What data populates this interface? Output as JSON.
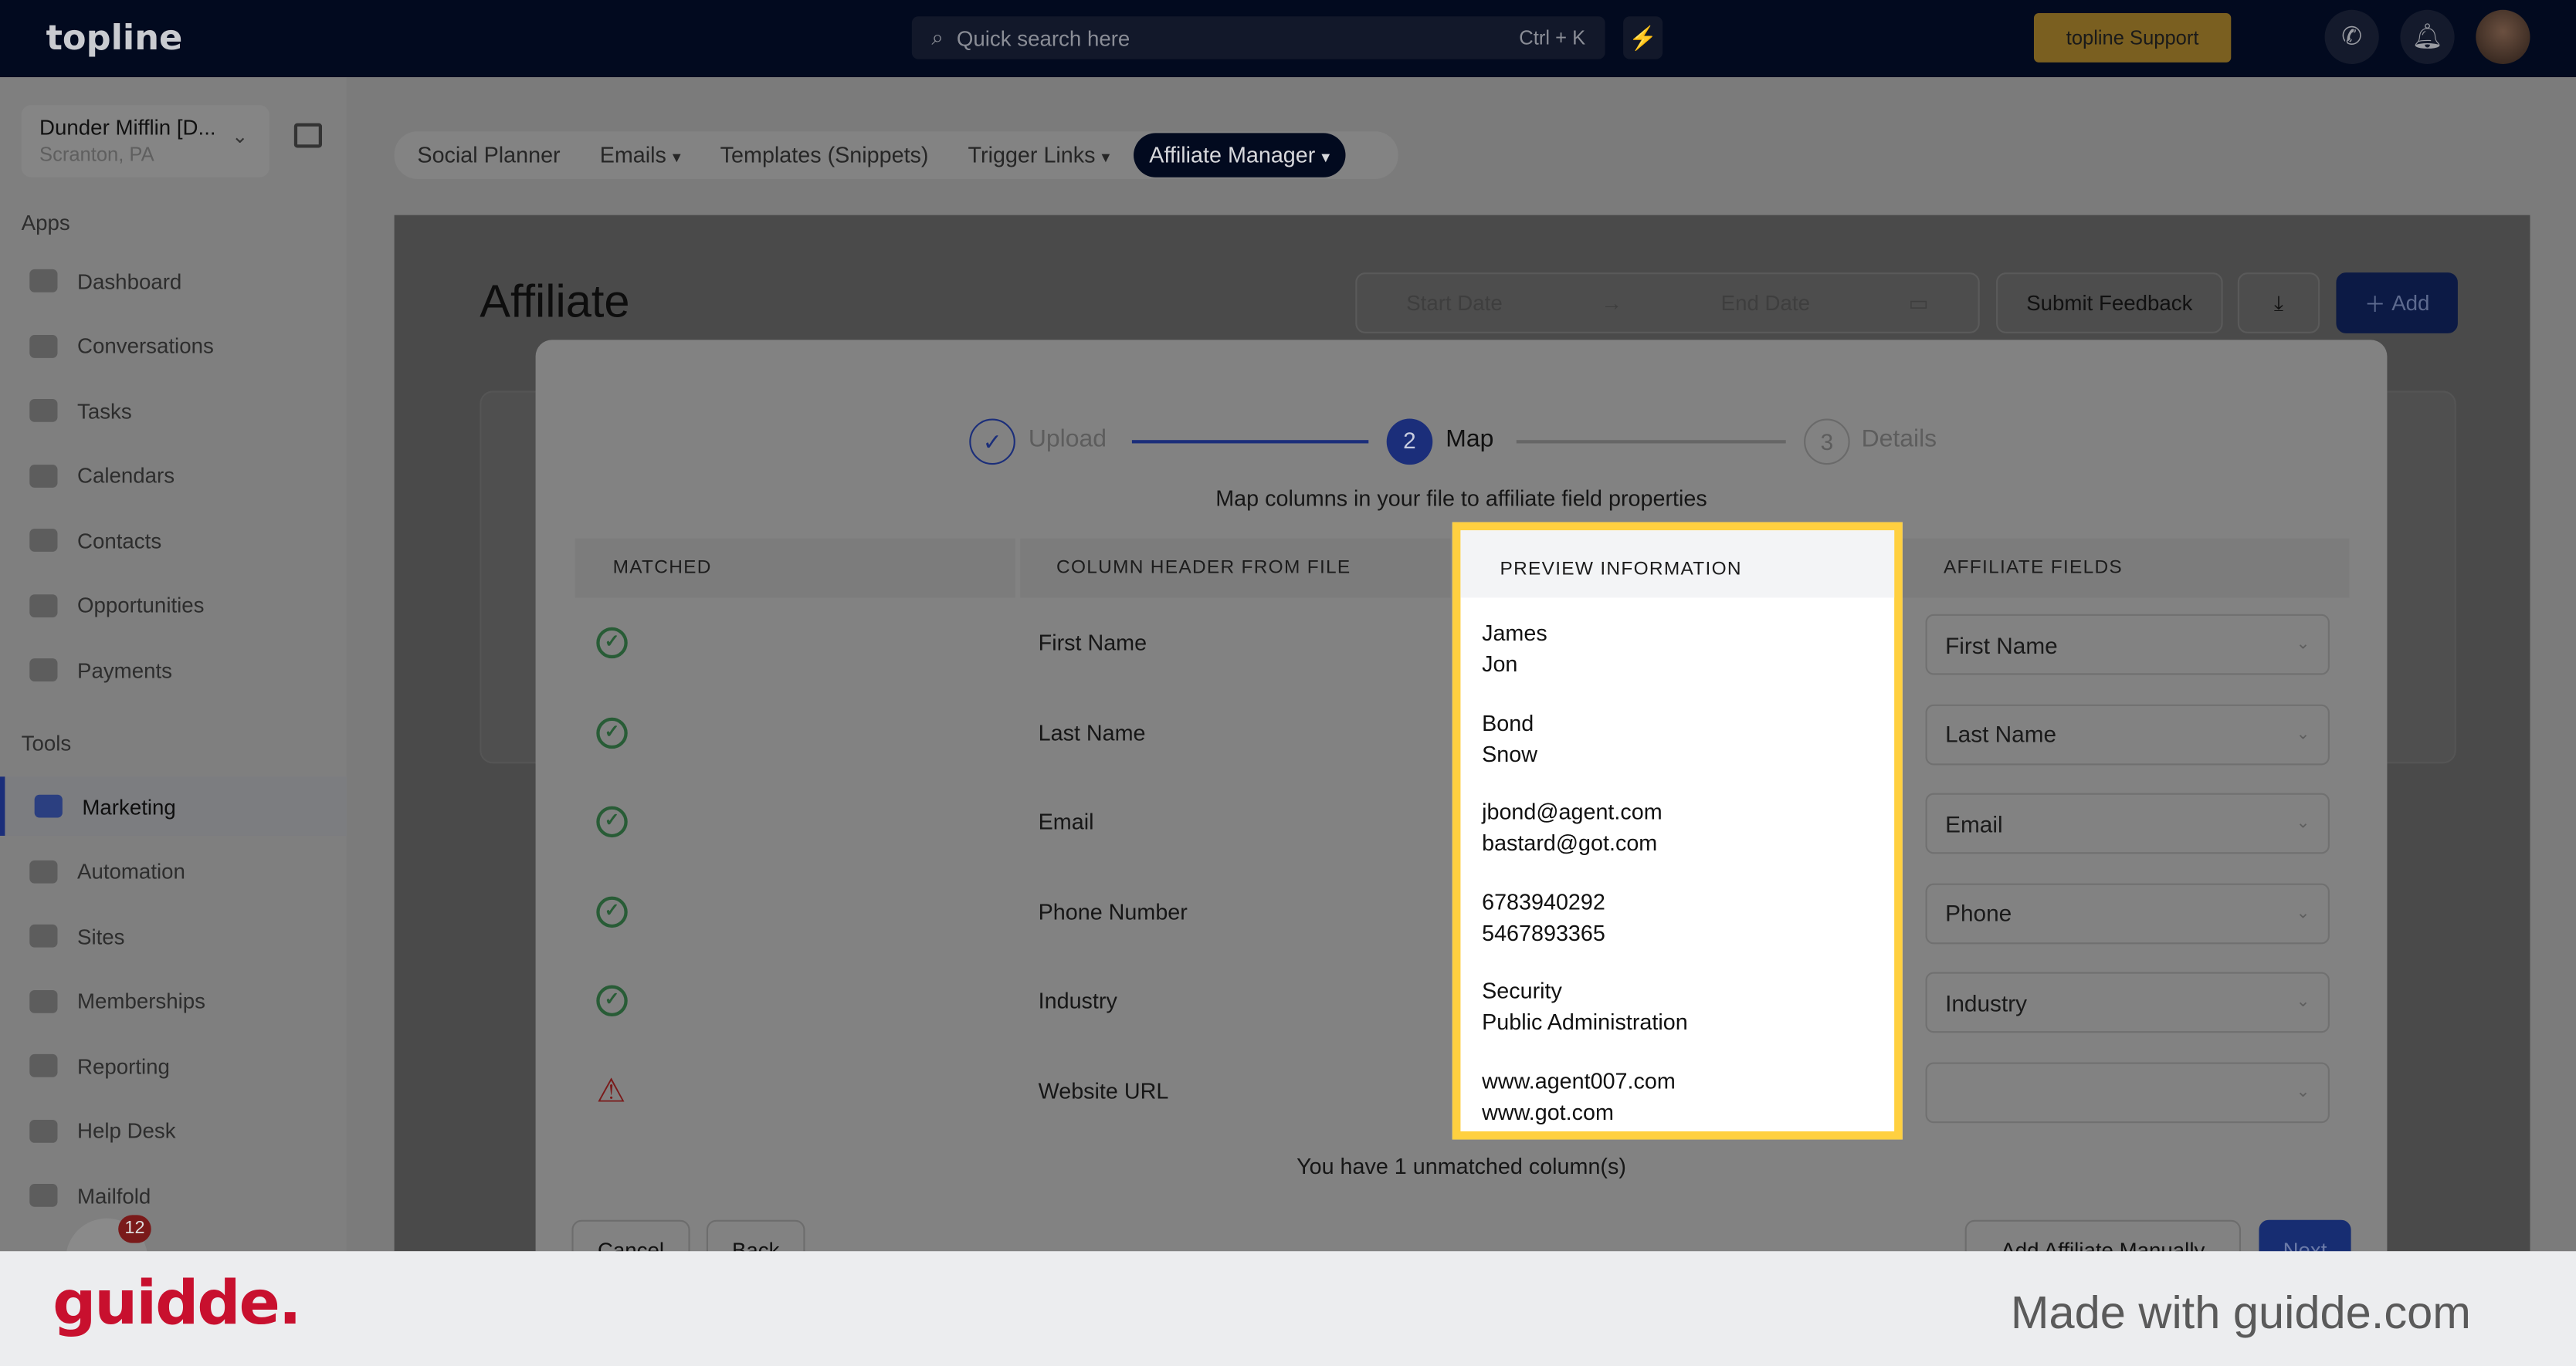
{
  "topbar": {
    "logo": "topline",
    "search_placeholder": "Quick search here",
    "search_shortcut": "Ctrl + K",
    "support_label": "topline Support"
  },
  "account": {
    "name": "Dunder Mifflin [D...",
    "location": "Scranton, PA"
  },
  "sidebar": {
    "apps_heading": "Apps",
    "apps": [
      {
        "label": "Dashboard",
        "icon": "dashboard-icon"
      },
      {
        "label": "Conversations",
        "icon": "chat-icon"
      },
      {
        "label": "Tasks",
        "icon": "tasks-icon"
      },
      {
        "label": "Calendars",
        "icon": "calendar-icon"
      },
      {
        "label": "Contacts",
        "icon": "contact-icon"
      },
      {
        "label": "Opportunities",
        "icon": "target-icon"
      },
      {
        "label": "Payments",
        "icon": "card-icon"
      }
    ],
    "tools_heading": "Tools",
    "tools": [
      {
        "label": "Marketing",
        "icon": "megaphone-icon",
        "active": true
      },
      {
        "label": "Automation",
        "icon": "gears-icon"
      },
      {
        "label": "Sites",
        "icon": "globe-icon"
      },
      {
        "label": "Memberships",
        "icon": "users-icon"
      },
      {
        "label": "Reporting",
        "icon": "pie-icon"
      },
      {
        "label": "Help Desk",
        "icon": "help-icon"
      },
      {
        "label": "Mailfold",
        "icon": "mail-icon"
      }
    ],
    "chat_badge": "12"
  },
  "tabs": [
    "Social Planner",
    "Emails",
    "Templates (Snippets)",
    "Trigger Links",
    "Affiliate Manager"
  ],
  "page": {
    "title": "Affiliate",
    "start_date": "Start Date",
    "end_date": "End Date",
    "submit_feedback": "Submit Feedback",
    "add": "Add"
  },
  "modal": {
    "steps": [
      {
        "num": "✓",
        "label": "Upload"
      },
      {
        "num": "2",
        "label": "Map"
      },
      {
        "num": "3",
        "label": "Details"
      }
    ],
    "subtitle": "Map columns in your file to affiliate field properties",
    "headers": {
      "matched": "MATCHED",
      "column": "COLUMN HEADER FROM FILE",
      "preview": "PREVIEW INFORMATION",
      "fields": "AFFILIATE FIELDS"
    },
    "rows": [
      {
        "column": "First Name",
        "preview1": "James",
        "preview2": "Jon",
        "field": "First Name",
        "matched": true
      },
      {
        "column": "Last Name",
        "preview1": "Bond",
        "preview2": "Snow",
        "field": "Last Name",
        "matched": true
      },
      {
        "column": "Email",
        "preview1": "jbond@agent.com",
        "preview2": "bastard@got.com",
        "field": "Email",
        "matched": true
      },
      {
        "column": "Phone Number",
        "preview1": "6783940292",
        "preview2": "5467893365",
        "field": "Phone",
        "matched": true
      },
      {
        "column": "Industry",
        "preview1": "Security",
        "preview2": "Public Administration",
        "field": "Industry",
        "matched": true
      },
      {
        "column": "Website URL",
        "preview1": "www.agent007.com",
        "preview2": "www.got.com",
        "field": "",
        "matched": false
      }
    ],
    "unmatched": "You have 1 unmatched column(s)",
    "cancel": "Cancel",
    "back": "Back",
    "add_manually": "Add Affiliate Manually",
    "next": "Next"
  },
  "footer": {
    "logo": "guidde.",
    "made_with": "Made with guidde.com"
  },
  "colors": {
    "highlight": "#ffd040",
    "primary": "#1b2e7a",
    "brand_red": "#c8102e"
  }
}
